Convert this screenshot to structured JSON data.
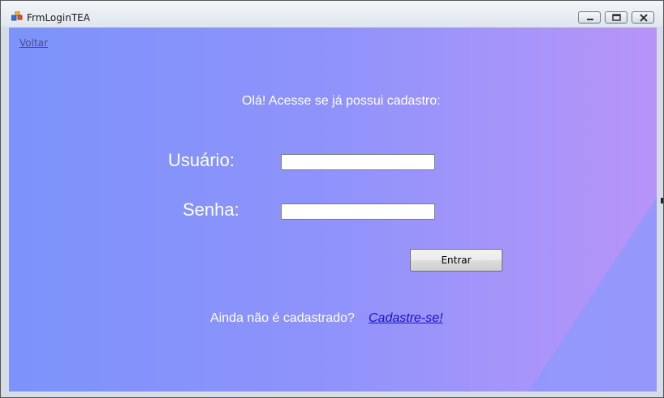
{
  "window": {
    "title": "FrmLoginTEA",
    "app_icon": "winforms-app-icon",
    "controls": [
      "minimize-icon",
      "maximize-icon",
      "close-icon"
    ]
  },
  "nav": {
    "back_link": "Voltar"
  },
  "login": {
    "greeting": "Olá! Acesse se já possui cadastro:",
    "user_label": "Usuário:",
    "user_value": "",
    "password_label": "Senha:",
    "password_value": "",
    "submit_label": "Entrar"
  },
  "register": {
    "prompt": "Ainda não é cadastrado?",
    "link": "Cadastre-se!"
  },
  "colors": {
    "background_start": "#7c93fb",
    "background_end": "#b793f8",
    "link": "#1a10cc",
    "text": "#ffffff"
  }
}
